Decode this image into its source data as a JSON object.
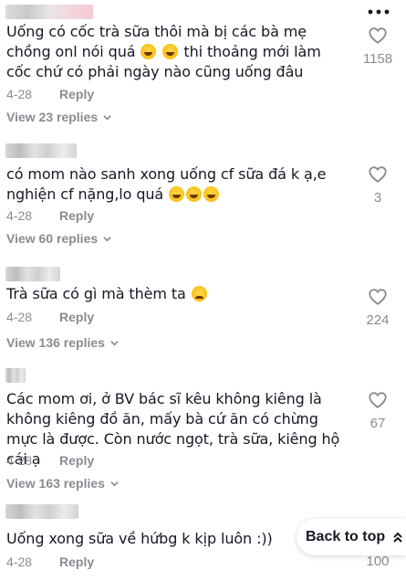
{
  "comments": [
    {
      "text_parts": [
        "Uống có cốc trà sữa thôi mà bị các bà mẹ chồng onl nói quá ",
        " ",
        " thi thoảng mới làm cốc chứ có phải ngày nào cũng uống đâu"
      ],
      "date": "4-28",
      "reply_label": "Reply",
      "view_replies": "View 23 replies",
      "likes": "1158",
      "emoji_icons": [
        "rofl-emoji",
        "rofl-emoji"
      ]
    },
    {
      "text_parts": [
        "có mom nào sanh xong uống cf sữa đá k ạ,e nghiện cf nặng,lo quá "
      ],
      "date": "4-28",
      "reply_label": "Reply",
      "view_replies": "View 60 replies",
      "likes": "3",
      "emoji_icons": [
        "rofl-emoji",
        "rofl-emoji",
        "rofl-emoji"
      ]
    },
    {
      "text_parts": [
        "Trà sữa có gì mà thèm ta "
      ],
      "date": "4-28",
      "reply_label": "Reply",
      "view_replies": "View 136 replies",
      "likes": "224",
      "emoji_icons": [
        "slightly-frowning-emoji"
      ]
    },
    {
      "text_parts": [
        "Các mom ơi, ở BV bác sĩ kêu không kiêng là không kiêng đồ ăn, mấy bà cứ ăn có chừng mực là được. Còn nước ngọt, trà sữa, kiêng hộ cái ạ"
      ],
      "date": "4-28",
      "reply_label": "Reply",
      "view_replies": "View 163 replies",
      "likes": "67",
      "emoji_icons": []
    },
    {
      "text_parts": [
        "Uống xong sữa về hứbg k kịp luôn :))"
      ],
      "date": "4-28",
      "reply_label": "Reply",
      "likes": "100",
      "emoji_icons": []
    }
  ],
  "back_to_top": {
    "label": "Back to top",
    "icon": "double-chevron-up-icon"
  },
  "icons": {
    "more": "more-dots-icon",
    "like": "heart-outline-icon",
    "expand": "chevron-down-icon"
  }
}
